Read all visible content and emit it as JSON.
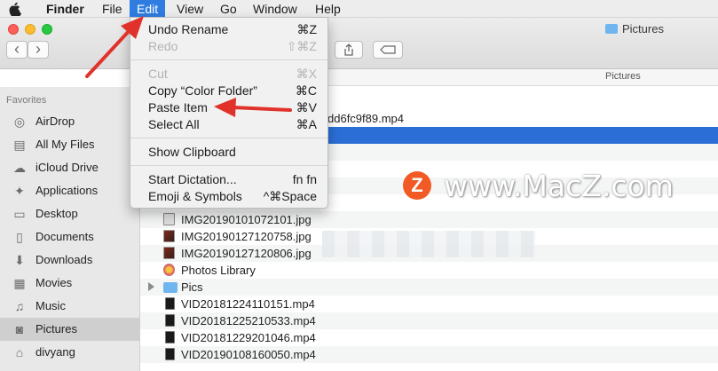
{
  "menubar": {
    "apple_icon": "apple-icon",
    "items": [
      "Finder",
      "File",
      "Edit",
      "View",
      "Go",
      "Window",
      "Help"
    ]
  },
  "window": {
    "title": "Pictures",
    "column_header": "Pictures",
    "nav_back": "‹",
    "nav_forward": "›"
  },
  "sidebar": {
    "heading": "Favorites",
    "items": [
      {
        "label": "AirDrop",
        "icon": "airdrop-icon"
      },
      {
        "label": "All My Files",
        "icon": "all-files-icon"
      },
      {
        "label": "iCloud Drive",
        "icon": "cloud-icon"
      },
      {
        "label": "Applications",
        "icon": "applications-icon"
      },
      {
        "label": "Desktop",
        "icon": "desktop-icon"
      },
      {
        "label": "Documents",
        "icon": "documents-icon"
      },
      {
        "label": "Downloads",
        "icon": "downloads-icon"
      },
      {
        "label": "Movies",
        "icon": "movies-icon"
      },
      {
        "label": "Music",
        "icon": "music-icon"
      },
      {
        "label": "Pictures",
        "icon": "camera-icon",
        "selected": true
      },
      {
        "label": "divyang",
        "icon": "home-icon"
      }
    ]
  },
  "files": {
    "partial_name": "dd6fc9f89.mp4",
    "rows": [
      {
        "name": "IMG20190101072101.jpg",
        "type": "shot"
      },
      {
        "name": "IMG20190127120758.jpg",
        "type": "img"
      },
      {
        "name": "IMG20190127120806.jpg",
        "type": "img"
      },
      {
        "name": "Photos Library",
        "type": "lib"
      },
      {
        "name": "Pics",
        "type": "fold"
      },
      {
        "name": "VID20181224110151.mp4",
        "type": "vid"
      },
      {
        "name": "VID20181225210533.mp4",
        "type": "vid"
      },
      {
        "name": "VID20181229201046.mp4",
        "type": "vid"
      },
      {
        "name": "VID20190108160050.mp4",
        "type": "vid"
      }
    ]
  },
  "edit_menu": {
    "undo": {
      "label": "Undo Rename",
      "shortcut": "⌘Z"
    },
    "redo": {
      "label": "Redo",
      "shortcut": "⇧⌘Z"
    },
    "cut": {
      "label": "Cut",
      "shortcut": "⌘X"
    },
    "copy": {
      "label": "Copy “Color Folder”",
      "shortcut": "⌘C"
    },
    "paste": {
      "label": "Paste Item",
      "shortcut": "⌘V"
    },
    "select_all": {
      "label": "Select All",
      "shortcut": "⌘A"
    },
    "show_clipboard": {
      "label": "Show Clipboard"
    },
    "start_dictation": {
      "label": "Start Dictation...",
      "shortcut": "fn fn"
    },
    "emoji": {
      "label": "Emoji & Symbols",
      "shortcut": "^⌘Space"
    }
  },
  "watermark": {
    "logo": "Z",
    "text": "www.MacZ.com"
  },
  "colors": {
    "accent": "#2f7de1",
    "selection": "#2b6fd6",
    "arrow": "#e0322a"
  }
}
